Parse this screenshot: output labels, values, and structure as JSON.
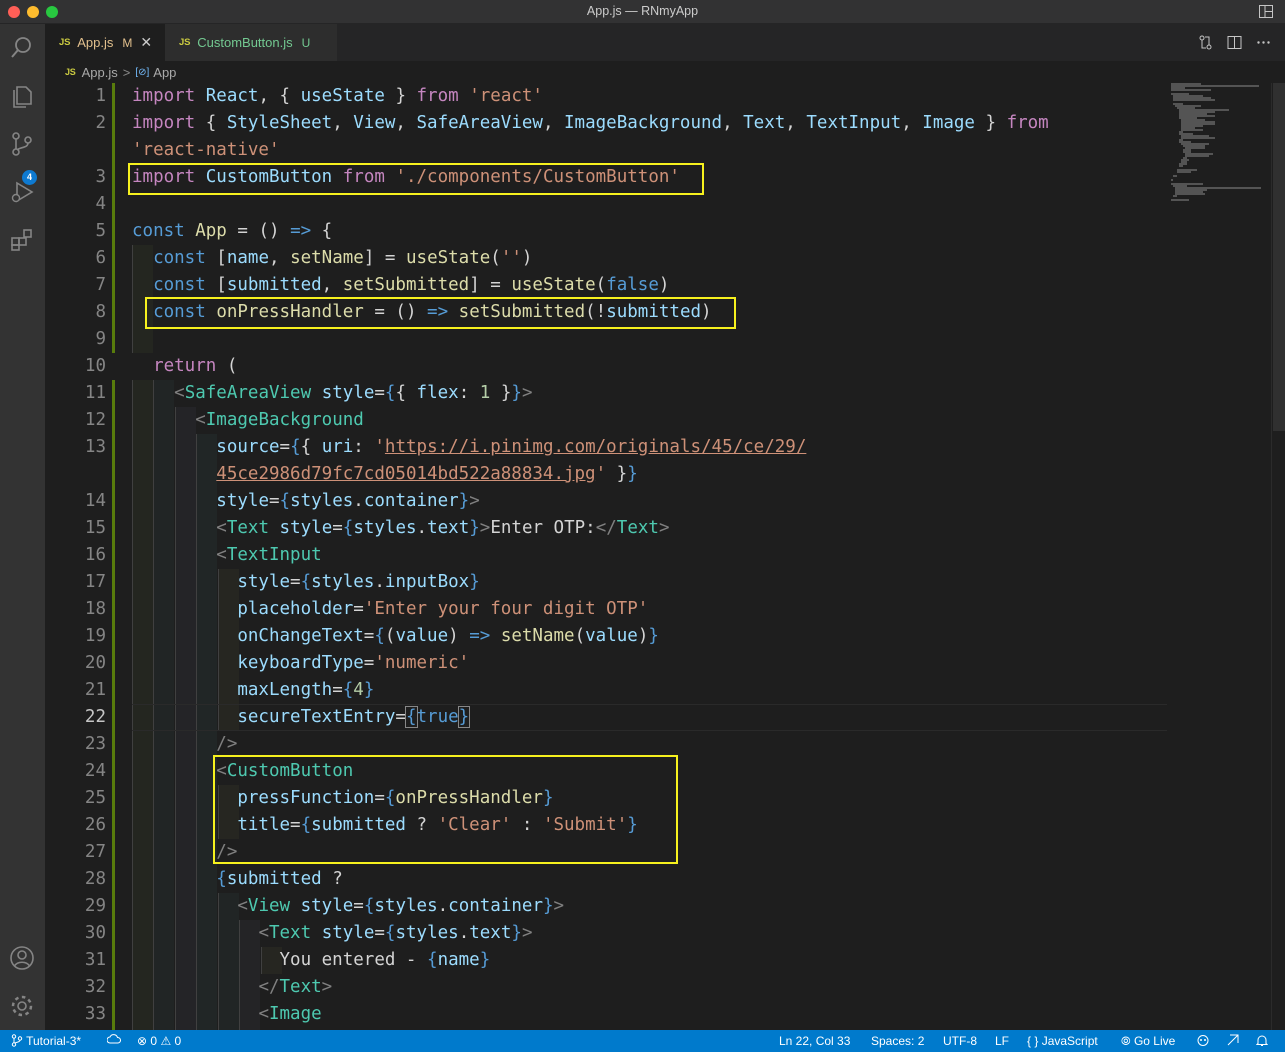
{
  "window": {
    "title": "App.js — RNmyApp"
  },
  "activity_bar": {
    "items": [
      "explorer",
      "search",
      "source-control",
      "run-debug",
      "extensions"
    ],
    "source_control_badge": "4"
  },
  "tabs": [
    {
      "icon": "JS",
      "name": "App.js",
      "status": "M",
      "close": "✕"
    },
    {
      "icon": "JS",
      "name": "CustomButton.js",
      "status": "U"
    }
  ],
  "breadcrumb": {
    "icon": "JS",
    "file": "App.js",
    "separator": ">",
    "symbol_icon": "[⊘]",
    "symbol": "App"
  },
  "editor": {
    "line_numbers": [
      "1",
      "2",
      "",
      "3",
      "4",
      "5",
      "6",
      "7",
      "8",
      "9",
      "10",
      "11",
      "12",
      "13",
      "",
      "14",
      "15",
      "16",
      "17",
      "18",
      "19",
      "20",
      "21",
      "22",
      "23",
      "24",
      "25",
      "26",
      "27",
      "28",
      "29",
      "30",
      "31",
      "32",
      "33"
    ],
    "active_line": "22"
  },
  "status_bar": {
    "branch": "Tutorial-3*",
    "errors": "0",
    "warnings": "0",
    "position": "Ln 22, Col 33",
    "spaces": "Spaces: 2",
    "encoding": "UTF-8",
    "eol": "LF",
    "language": "JavaScript",
    "language_icon": "{ }",
    "go_live": "Go Live"
  },
  "colors": {
    "accent": "#007acc",
    "highlight_box": "#f6f11e",
    "badge": "#0e7ad1"
  }
}
